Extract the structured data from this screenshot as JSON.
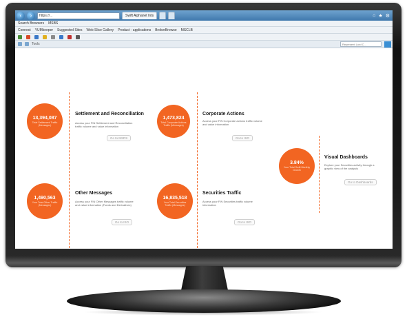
{
  "browser": {
    "address": "https://...",
    "tabs": [
      "Swift Alphanet Ints",
      "",
      ""
    ],
    "menu": [
      "Search Browsers",
      "MSBS"
    ],
    "favorites": [
      "Connect",
      "YUMkeeper",
      "Suggested Sites",
      "Web Slice Gallery",
      "Product - applications",
      "BrokerBrowse",
      "MSCLB"
    ],
    "command_label": "Tools",
    "search_placeholder": "Represent Lord C...",
    "icons": {
      "back": "back-arrow-icon",
      "forward": "forward-arrow-icon"
    }
  },
  "cards": [
    {
      "value": "13,394,087",
      "caption": "Total Settlement Traffic (Messages)",
      "title": "Settlement and Reconciliation",
      "description": "Access your FIN Settlement and Reconciliation traffic volume and value information",
      "link": "Go to MSRS"
    },
    {
      "value": "1,473,824",
      "caption": "Total Corporate Actions Traffic (Messages)",
      "title": "Corporate Actions",
      "description": "Access your FIN Corporate actions traffic volume and value information",
      "link": "Go to ISO"
    },
    {
      "value": "3.84%",
      "caption": "Your Total Swift Monthly Growth",
      "title": "Visual Dashboards",
      "description": "Explore your Securities activity through a graphic view of the analysis",
      "link": "Go to Dashboards"
    },
    {
      "value": "1,490,563",
      "caption": "Your Total Other Traffic (Messages)",
      "title": "Other Messages",
      "description": "Access your FIN Other Messages traffic volume and value information (Funds and Derivatives)",
      "link": "Go to ISO"
    },
    {
      "value": "16,835,518",
      "caption": "Your Total Securities Traffic (Messages)",
      "title": "Securities Traffic",
      "description": "Access your FIN Securities traffic volume information",
      "link": "Go to ISO"
    }
  ],
  "colors": {
    "accent": "#f26522",
    "chrome": "#3f78ad"
  }
}
